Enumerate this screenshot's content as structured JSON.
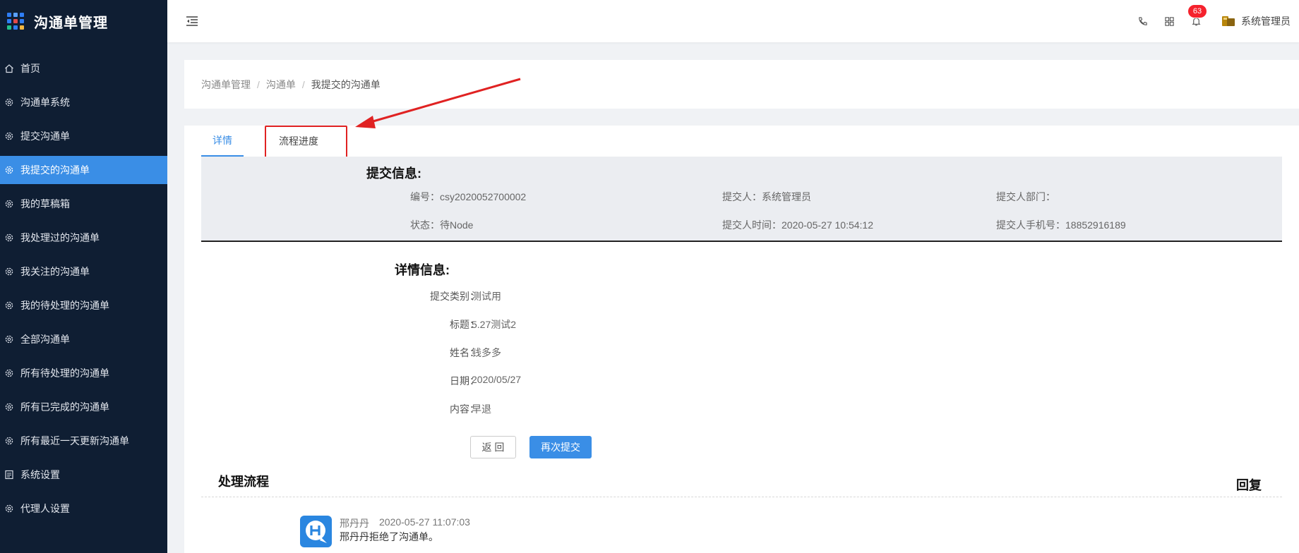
{
  "app": {
    "title": "沟通单管理"
  },
  "sidebar": {
    "items": [
      {
        "label": "首页",
        "icon": "home-icon"
      },
      {
        "label": "沟通单系统",
        "icon": "gear-icon"
      },
      {
        "label": "提交沟通单",
        "icon": "gear-icon"
      },
      {
        "label": "我提交的沟通单",
        "icon": "gear-icon",
        "active": true
      },
      {
        "label": "我的草稿箱",
        "icon": "gear-icon"
      },
      {
        "label": "我处理过的沟通单",
        "icon": "gear-icon"
      },
      {
        "label": "我关注的沟通单",
        "icon": "gear-icon"
      },
      {
        "label": "我的待处理的沟通单",
        "icon": "gear-icon"
      },
      {
        "label": "全部沟通单",
        "icon": "gear-icon"
      },
      {
        "label": "所有待处理的沟通单",
        "icon": "gear-icon"
      },
      {
        "label": "所有已完成的沟通单",
        "icon": "gear-icon"
      },
      {
        "label": "所有最近一天更新沟通单",
        "icon": "gear-icon"
      },
      {
        "label": "系统设置",
        "icon": "document-icon"
      },
      {
        "label": "代理人设置",
        "icon": "gear-icon"
      }
    ]
  },
  "header": {
    "notification_count": "63",
    "user_name": "系统管理员"
  },
  "breadcrumb": {
    "items": [
      "沟通单管理",
      "沟通单",
      "我提交的沟通单"
    ]
  },
  "tabs": [
    {
      "label": "详情",
      "active": true
    },
    {
      "label": "流程进度",
      "active": false
    }
  ],
  "submit_info": {
    "title": "提交信息:",
    "number": "编号：csy2020052700002",
    "submitter": "提交人：系统管理员",
    "department": "提交人部门：",
    "status": "状态：待Node",
    "submit_time": "提交人时间：2020-05-27 10:54:12",
    "phone": "提交人手机号：18852916189"
  },
  "detail_info": {
    "title": "详情信息:",
    "rows": [
      {
        "label": "提交类别：",
        "value": "测试用"
      },
      {
        "label": "标题：",
        "value": "5.27测试2"
      },
      {
        "label": "姓名：",
        "value": "钱多多"
      },
      {
        "label": "日期：",
        "value": "2020/05/27"
      },
      {
        "label": "内容：",
        "value": "早退"
      }
    ]
  },
  "buttons": {
    "back": "返 回",
    "resubmit": "再次提交"
  },
  "process": {
    "title": "处理流程",
    "reply_title": "回复",
    "entries": [
      {
        "name": "邢丹丹",
        "time": "2020-05-27 11:07:03",
        "message": "邢丹丹拒绝了沟通单。"
      }
    ]
  },
  "colors": {
    "sidebar_bg": "#0f1e33",
    "accent": "#3a8ee6",
    "badge": "#f5222d",
    "annotation": "#e02222"
  }
}
